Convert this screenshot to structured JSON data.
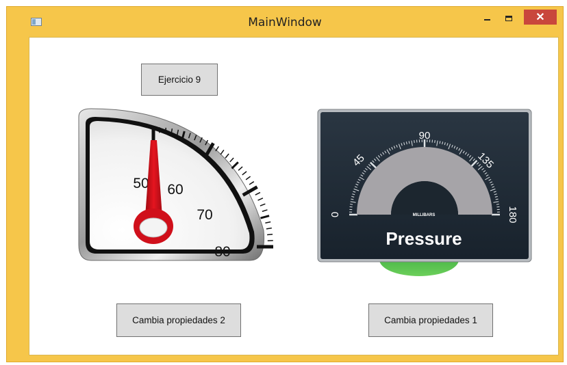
{
  "window": {
    "title": "MainWindow",
    "close_glyph": "✕"
  },
  "buttons": {
    "ejercicio": "Ejercicio 9",
    "cambia_2": "Cambia propiedades 2",
    "cambia_1": "Cambia propiedades 1"
  },
  "gauge_left": {
    "tick_labels": [
      "50",
      "60",
      "70",
      "80"
    ],
    "needle_value": 50,
    "needle_color": "#d0101b"
  },
  "gauge_right": {
    "tick_labels": [
      "0",
      "45",
      "90",
      "135",
      "180"
    ],
    "unit_label": "MILLIBARS",
    "title": "Pressure",
    "face_color": "#1e2a35"
  }
}
